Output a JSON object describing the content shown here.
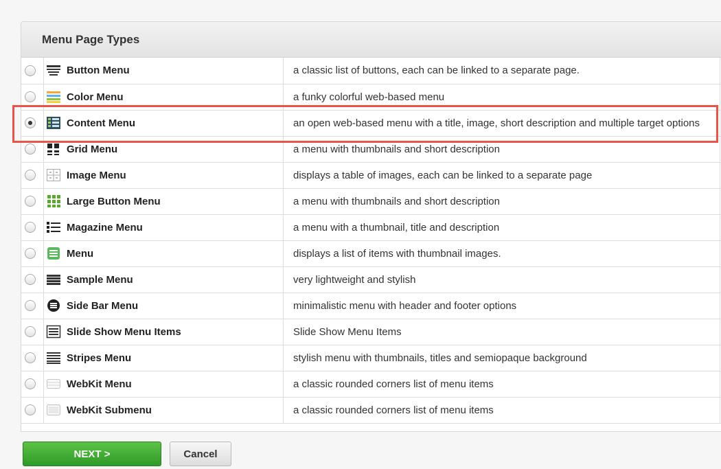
{
  "panel": {
    "title": "Menu Page Types"
  },
  "rows": [
    {
      "name": "Button Menu",
      "icon": "button-menu-icon",
      "description": "a classic list of buttons, each can be linked to a separate page.",
      "selected": false
    },
    {
      "name": "Color Menu",
      "icon": "color-menu-icon",
      "description": "a funky colorful web-based menu",
      "selected": false
    },
    {
      "name": "Content Menu",
      "icon": "content-menu-icon",
      "description": "an open web-based menu with a title, image, short description and multiple target options",
      "selected": true
    },
    {
      "name": "Grid Menu",
      "icon": "grid-menu-icon",
      "description": "a menu with thumbnails and short description",
      "selected": false
    },
    {
      "name": "Image Menu",
      "icon": "image-menu-icon",
      "description": "displays a table of images, each can be linked to a separate page",
      "selected": false
    },
    {
      "name": "Large Button Menu",
      "icon": "large-button-menu-icon",
      "description": "a menu with thumbnails and short description",
      "selected": false
    },
    {
      "name": "Magazine Menu",
      "icon": "magazine-menu-icon",
      "description": "a menu with a thumbnail, title and description",
      "selected": false
    },
    {
      "name": "Menu",
      "icon": "menu-icon",
      "description": "displays a list of items with thumbnail images.",
      "selected": false
    },
    {
      "name": "Sample Menu",
      "icon": "sample-menu-icon",
      "description": "very lightweight and stylish",
      "selected": false
    },
    {
      "name": "Side Bar Menu",
      "icon": "side-bar-menu-icon",
      "description": "minimalistic menu with header and footer options",
      "selected": false
    },
    {
      "name": "Slide Show Menu Items",
      "icon": "slide-show-menu-icon",
      "description": "Slide Show Menu Items",
      "selected": false
    },
    {
      "name": "Stripes Menu",
      "icon": "stripes-menu-icon",
      "description": "stylish menu with thumbnails, titles and semiopaque background",
      "selected": false
    },
    {
      "name": "WebKit Menu",
      "icon": "webkit-menu-icon",
      "description": "a classic rounded corners list of menu items",
      "selected": false
    },
    {
      "name": "WebKit Submenu",
      "icon": "webkit-submenu-icon",
      "description": "a classic rounded corners list of menu items",
      "selected": false
    }
  ],
  "buttons": {
    "next": "NEXT >",
    "cancel": "Cancel"
  },
  "colors": {
    "next_button": "#3aa52f",
    "highlight_border": "#e8534a"
  }
}
